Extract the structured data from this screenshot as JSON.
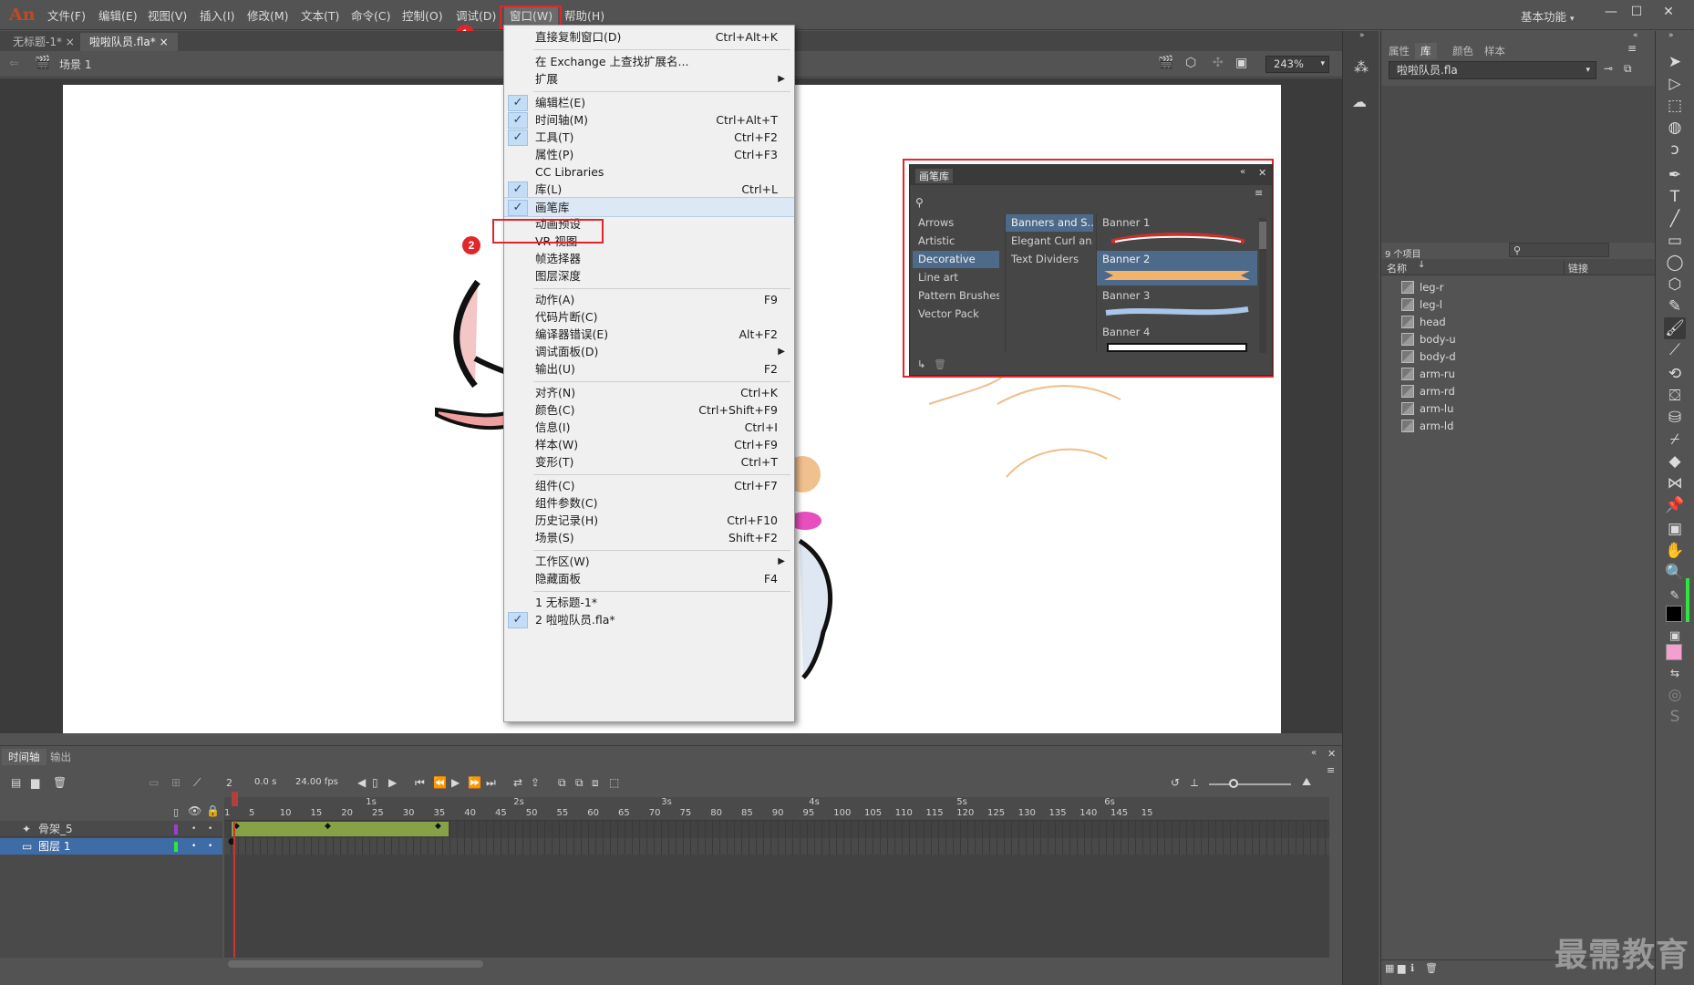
{
  "app": {
    "logo": "An",
    "workspace": "基本功能",
    "menus": [
      "文件(F)",
      "编辑(E)",
      "视图(V)",
      "插入(I)",
      "修改(M)",
      "文本(T)",
      "命令(C)",
      "控制(O)",
      "调试(D)",
      "窗口(W)",
      "帮助(H)"
    ],
    "window_buttons": [
      "—",
      "☐",
      "✕"
    ]
  },
  "annotations": {
    "badge1": "1",
    "badge2": "2"
  },
  "doc_tabs": [
    "无标题-1*",
    "啦啦队员.fla*"
  ],
  "edit_bar": {
    "scene": "场景 1",
    "zoom": "243%"
  },
  "window_menu": {
    "items": [
      {
        "label": "直接复制窗口(D)",
        "shortcut": "Ctrl+Alt+K"
      },
      {
        "label": "在 Exchange 上查找扩展名..."
      },
      {
        "label": "扩展",
        "submenu": true
      },
      {
        "label": "编辑栏(E)",
        "checked": true
      },
      {
        "label": "时间轴(M)",
        "shortcut": "Ctrl+Alt+T",
        "checked": true
      },
      {
        "label": "工具(T)",
        "shortcut": "Ctrl+F2",
        "checked": true
      },
      {
        "label": "属性(P)",
        "shortcut": "Ctrl+F3"
      },
      {
        "label": "CC Libraries"
      },
      {
        "label": "库(L)",
        "shortcut": "Ctrl+L",
        "checked": true
      },
      {
        "label": "画笔库",
        "checked": true,
        "selected": true
      },
      {
        "label": "动画预设"
      },
      {
        "label": "VR 视图"
      },
      {
        "label": "帧选择器"
      },
      {
        "label": "图层深度"
      },
      {
        "label": "动作(A)",
        "shortcut": "F9"
      },
      {
        "label": "代码片断(C)"
      },
      {
        "label": "编译器错误(E)",
        "shortcut": "Alt+F2"
      },
      {
        "label": "调试面板(D)",
        "submenu": true
      },
      {
        "label": "输出(U)",
        "shortcut": "F2"
      },
      {
        "label": "对齐(N)",
        "shortcut": "Ctrl+K"
      },
      {
        "label": "颜色(C)",
        "shortcut": "Ctrl+Shift+F9"
      },
      {
        "label": "信息(I)",
        "shortcut": "Ctrl+I"
      },
      {
        "label": "样本(W)",
        "shortcut": "Ctrl+F9"
      },
      {
        "label": "变形(T)",
        "shortcut": "Ctrl+T"
      },
      {
        "label": "组件(C)",
        "shortcut": "Ctrl+F7"
      },
      {
        "label": "组件参数(C)"
      },
      {
        "label": "历史记录(H)",
        "shortcut": "Ctrl+F10"
      },
      {
        "label": "场景(S)",
        "shortcut": "Shift+F2"
      },
      {
        "label": "工作区(W)",
        "submenu": true
      },
      {
        "label": "隐藏面板",
        "shortcut": "F4"
      },
      {
        "label": "1 无标题-1*"
      },
      {
        "label": "2 啦啦队员.fla*",
        "checked": true
      }
    ]
  },
  "brush_library": {
    "title": "画笔库",
    "categories": [
      "Arrows",
      "Artistic",
      "Decorative",
      "Line art",
      "Pattern Brushes",
      "Vector Pack"
    ],
    "selected_category": "Decorative",
    "subcategories": [
      "Banners and S...",
      "Elegant Curl an...",
      "Text Dividers"
    ],
    "brushes": [
      "Banner 1",
      "Banner 2",
      "Banner 3",
      "Banner 4"
    ],
    "selected_brush": "Banner 2"
  },
  "timeline": {
    "tabs": [
      "时间轴",
      "输出"
    ],
    "current_frame": "2",
    "time": "0.0 s",
    "fps": "24.00 fps",
    "ruler_numbers": [
      "1",
      "5",
      "10",
      "15",
      "20",
      "25",
      "30",
      "35",
      "40",
      "45",
      "50",
      "55",
      "60",
      "65",
      "70",
      "75",
      "80",
      "85",
      "90",
      "95",
      "100",
      "105",
      "110",
      "115",
      "120",
      "125",
      "130",
      "135",
      "140",
      "145",
      "15"
    ],
    "seconds": [
      "1s",
      "2s",
      "3s",
      "4s",
      "5s",
      "6s"
    ],
    "layers": [
      {
        "name": "骨架_5",
        "color": "#9b3fd2"
      },
      {
        "name": "图层 1",
        "color": "#2ee63d"
      }
    ]
  },
  "library_panel": {
    "tabs": [
      "属性",
      "库",
      "颜色",
      "样本"
    ],
    "active_tab": "库",
    "document": "啦啦队员.fla",
    "count": "9 个项目",
    "col_name": "名称",
    "col_link": "链接",
    "items": [
      "leg-r",
      "leg-l",
      "head",
      "body-u",
      "body-d",
      "arm-ru",
      "arm-rd",
      "arm-lu",
      "arm-ld"
    ]
  },
  "colors": {
    "accent_red": "#e0262b",
    "stroke": "#000000",
    "fill": "#f39fd0"
  },
  "watermark": "最需教育"
}
